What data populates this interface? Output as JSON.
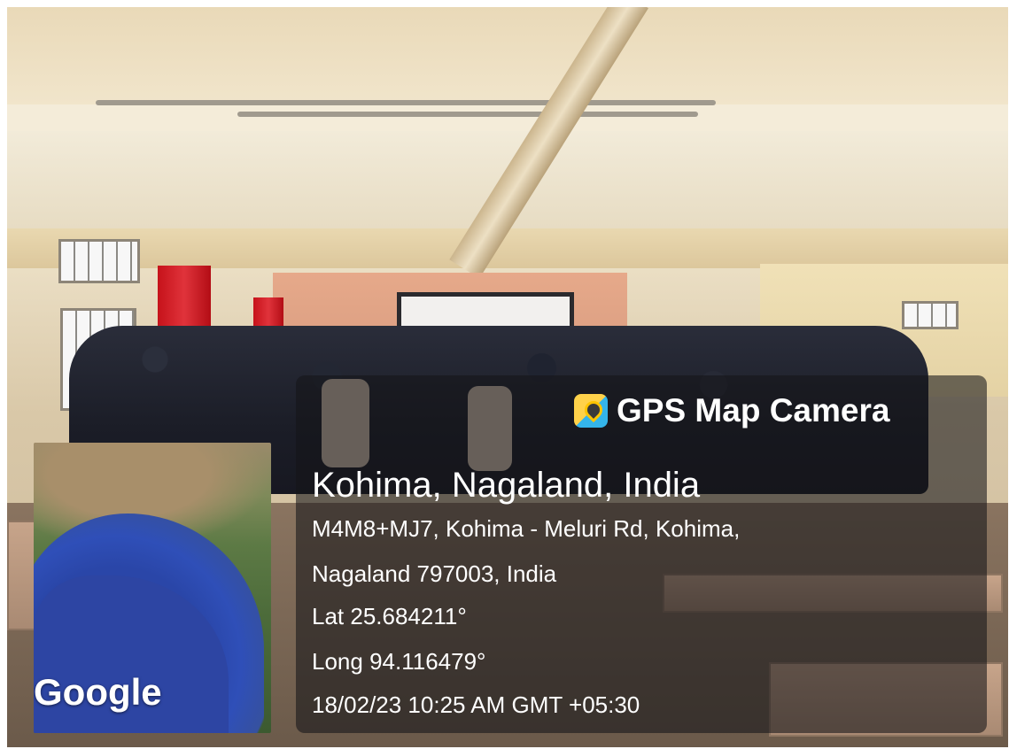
{
  "overlay": {
    "app_name": "GPS Map Camera",
    "place": "Kohima, Nagaland, India",
    "address_line1": "M4M8+MJ7, Kohima - Meluri Rd, Kohima,",
    "address_line2": "Nagaland 797003, India",
    "latitude": "Lat 25.684211°",
    "longitude": "Long 94.116479°",
    "datetime": "18/02/23 10:25 AM GMT +05:30"
  },
  "map": {
    "attribution": "Google"
  },
  "icons": {
    "app_icon": "gps-map-camera-app-icon"
  },
  "colors": {
    "panel_bg": "#141418",
    "text": "#ffffff",
    "sea": "#2d45a3",
    "land": "#5d7a45"
  }
}
